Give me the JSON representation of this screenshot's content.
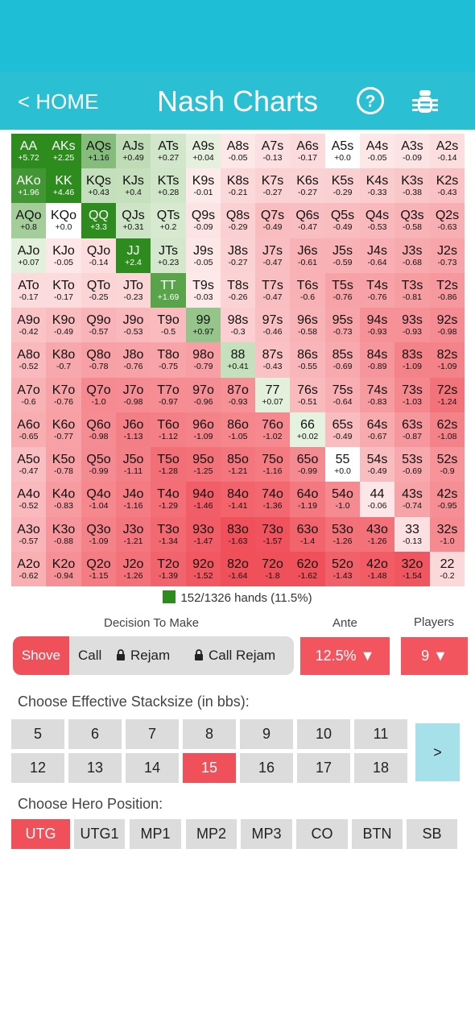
{
  "header": {
    "back_label": "< HOME",
    "title": "Nash Charts"
  },
  "colors": {
    "header": "#2bbfd4",
    "accent": "#f0505a",
    "strong_green": "#2e8b1e",
    "next_button": "#a6e1ea"
  },
  "icons": {
    "help": "help-circle-icon",
    "bug": "bug-icon",
    "lock": "lock-icon"
  },
  "chart_data": {
    "type": "heatmap",
    "hands": [
      [
        "AA",
        "AKs",
        "AQs",
        "AJs",
        "ATs",
        "A9s",
        "A8s",
        "A7s",
        "A6s",
        "A5s",
        "A4s",
        "A3s",
        "A2s"
      ],
      [
        "AKo",
        "KK",
        "KQs",
        "KJs",
        "KTs",
        "K9s",
        "K8s",
        "K7s",
        "K6s",
        "K5s",
        "K4s",
        "K3s",
        "K2s"
      ],
      [
        "AQo",
        "KQo",
        "QQ",
        "QJs",
        "QTs",
        "Q9s",
        "Q8s",
        "Q7s",
        "Q6s",
        "Q5s",
        "Q4s",
        "Q3s",
        "Q2s"
      ],
      [
        "AJo",
        "KJo",
        "QJo",
        "JJ",
        "JTs",
        "J9s",
        "J8s",
        "J7s",
        "J6s",
        "J5s",
        "J4s",
        "J3s",
        "J2s"
      ],
      [
        "ATo",
        "KTo",
        "QTo",
        "JTo",
        "TT",
        "T9s",
        "T8s",
        "T7s",
        "T6s",
        "T5s",
        "T4s",
        "T3s",
        "T2s"
      ],
      [
        "A9o",
        "K9o",
        "Q9o",
        "J9o",
        "T9o",
        "99",
        "98s",
        "97s",
        "96s",
        "95s",
        "94s",
        "93s",
        "92s"
      ],
      [
        "A8o",
        "K8o",
        "Q8o",
        "J8o",
        "T8o",
        "98o",
        "88",
        "87s",
        "86s",
        "85s",
        "84s",
        "83s",
        "82s"
      ],
      [
        "A7o",
        "K7o",
        "Q7o",
        "J7o",
        "T7o",
        "97o",
        "87o",
        "77",
        "76s",
        "75s",
        "74s",
        "73s",
        "72s"
      ],
      [
        "A6o",
        "K6o",
        "Q6o",
        "J6o",
        "T6o",
        "96o",
        "86o",
        "76o",
        "66",
        "65s",
        "64s",
        "63s",
        "62s"
      ],
      [
        "A5o",
        "K5o",
        "Q5o",
        "J5o",
        "T5o",
        "95o",
        "85o",
        "75o",
        "65o",
        "55",
        "54s",
        "53s",
        "52s"
      ],
      [
        "A4o",
        "K4o",
        "Q4o",
        "J4o",
        "T4o",
        "94o",
        "84o",
        "74o",
        "64o",
        "54o",
        "44",
        "43s",
        "42s"
      ],
      [
        "A3o",
        "K3o",
        "Q3o",
        "J3o",
        "T3o",
        "93o",
        "83o",
        "73o",
        "63o",
        "53o",
        "43o",
        "33",
        "32s"
      ],
      [
        "A2o",
        "K2o",
        "Q2o",
        "J2o",
        "T2o",
        "92o",
        "82o",
        "72o",
        "62o",
        "52o",
        "42o",
        "32o",
        "22"
      ]
    ],
    "value_labels": [
      [
        "+5.72",
        "+2.25",
        "+1.16",
        "+0.49",
        "+0.27",
        "+0.04",
        "-0.05",
        "-0.13",
        "-0.17",
        "+0.0",
        "-0.05",
        "-0.09",
        "-0.14"
      ],
      [
        "+1.96",
        "+4.46",
        "+0.43",
        "+0.4",
        "+0.28",
        "-0.01",
        "-0.21",
        "-0.27",
        "-0.27",
        "-0.29",
        "-0.33",
        "-0.38",
        "-0.43"
      ],
      [
        "+0.8",
        "+0.0",
        "+3.3",
        "+0.31",
        "+0.2",
        "-0.09",
        "-0.29",
        "-0.49",
        "-0.47",
        "-0.49",
        "-0.53",
        "-0.58",
        "-0.63"
      ],
      [
        "+0.07",
        "-0.05",
        "-0.14",
        "+2.4",
        "+0.23",
        "-0.05",
        "-0.27",
        "-0.47",
        "-0.61",
        "-0.59",
        "-0.64",
        "-0.68",
        "-0.73"
      ],
      [
        "-0.17",
        "-0.17",
        "-0.25",
        "-0.23",
        "+1.69",
        "-0.03",
        "-0.26",
        "-0.47",
        "-0.6",
        "-0.76",
        "-0.76",
        "-0.81",
        "-0.86"
      ],
      [
        "-0.42",
        "-0.49",
        "-0.57",
        "-0.53",
        "-0.5",
        "+0.97",
        "-0.3",
        "-0.46",
        "-0.58",
        "-0.73",
        "-0.93",
        "-0.93",
        "-0.98"
      ],
      [
        "-0.52",
        "-0.7",
        "-0.78",
        "-0.76",
        "-0.75",
        "-0.79",
        "+0.41",
        "-0.43",
        "-0.55",
        "-0.69",
        "-0.89",
        "-1.09",
        "-1.09"
      ],
      [
        "-0.6",
        "-0.76",
        "-1.0",
        "-0.98",
        "-0.97",
        "-0.96",
        "-0.93",
        "+0.07",
        "-0.51",
        "-0.64",
        "-0.83",
        "-1.03",
        "-1.24"
      ],
      [
        "-0.65",
        "-0.77",
        "-0.98",
        "-1.13",
        "-1.12",
        "-1.09",
        "-1.05",
        "-1.02",
        "+0.02",
        "-0.49",
        "-0.67",
        "-0.87",
        "-1.08"
      ],
      [
        "-0.47",
        "-0.78",
        "-0.99",
        "-1.11",
        "-1.28",
        "-1.25",
        "-1.21",
        "-1.16",
        "-0.99",
        "+0.0",
        "-0.49",
        "-0.69",
        "-0.9"
      ],
      [
        "-0.52",
        "-0.83",
        "-1.04",
        "-1.16",
        "-1.29",
        "-1.46",
        "-1.41",
        "-1.36",
        "-1.19",
        "-1.0",
        "-0.06",
        "-0.74",
        "-0.95"
      ],
      [
        "-0.57",
        "-0.88",
        "-1.09",
        "-1.21",
        "-1.34",
        "-1.47",
        "-1.63",
        "-1.57",
        "-1.4",
        "-1.26",
        "-1.26",
        "-0.13",
        "-1.0"
      ],
      [
        "-0.62",
        "-0.94",
        "-1.15",
        "-1.26",
        "-1.39",
        "-1.52",
        "-1.64",
        "-1.8",
        "-1.62",
        "-1.43",
        "-1.48",
        "-1.54",
        "-0.2"
      ]
    ]
  },
  "legend": {
    "text": "152/1326 hands (11.5%)"
  },
  "controls": {
    "decision_label": "Decision To Make",
    "ante_label": "Ante",
    "players_label": "Players",
    "decisions": [
      "Shove",
      "Call",
      "Rejam",
      "Call Rejam"
    ],
    "selected_decision": "Shove",
    "ante_value": "12.5% ▼",
    "players_value": "9 ▼"
  },
  "stacksize": {
    "label": "Choose Effective Stacksize (in bbs):",
    "row1": [
      "5",
      "6",
      "7",
      "8",
      "9",
      "10",
      "11"
    ],
    "row2": [
      "12",
      "13",
      "14",
      "15",
      "16",
      "17",
      "18"
    ],
    "selected": "15",
    "next_label": ">"
  },
  "position": {
    "label": "Choose Hero Position:",
    "options": [
      "UTG",
      "UTG1",
      "MP1",
      "MP2",
      "MP3",
      "CO",
      "BTN",
      "SB"
    ],
    "selected": "UTG"
  }
}
